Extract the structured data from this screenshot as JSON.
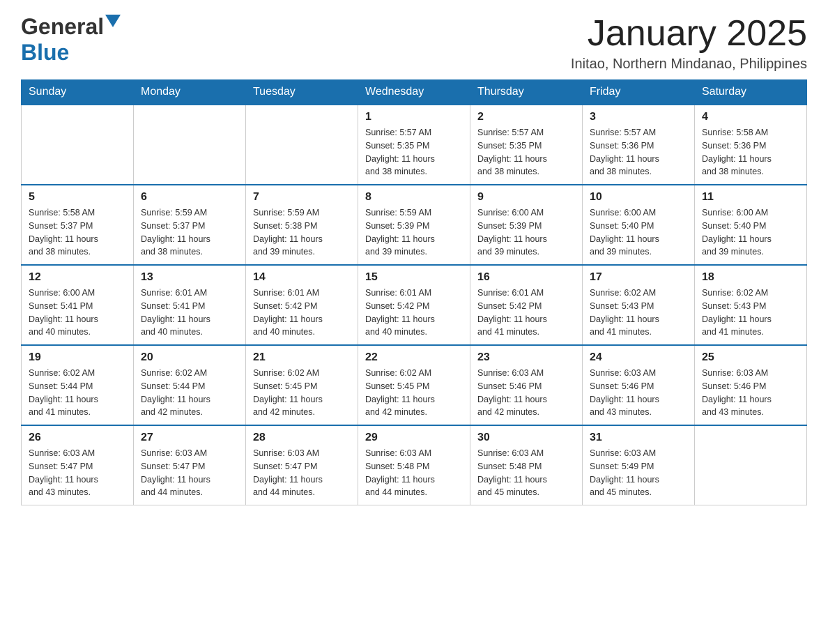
{
  "header": {
    "logo_general": "General",
    "logo_blue": "Blue",
    "month_title": "January 2025",
    "location": "Initao, Northern Mindanao, Philippines"
  },
  "days_of_week": [
    "Sunday",
    "Monday",
    "Tuesday",
    "Wednesday",
    "Thursday",
    "Friday",
    "Saturday"
  ],
  "weeks": [
    {
      "days": [
        {
          "number": "",
          "info": ""
        },
        {
          "number": "",
          "info": ""
        },
        {
          "number": "",
          "info": ""
        },
        {
          "number": "1",
          "info": "Sunrise: 5:57 AM\nSunset: 5:35 PM\nDaylight: 11 hours\nand 38 minutes."
        },
        {
          "number": "2",
          "info": "Sunrise: 5:57 AM\nSunset: 5:35 PM\nDaylight: 11 hours\nand 38 minutes."
        },
        {
          "number": "3",
          "info": "Sunrise: 5:57 AM\nSunset: 5:36 PM\nDaylight: 11 hours\nand 38 minutes."
        },
        {
          "number": "4",
          "info": "Sunrise: 5:58 AM\nSunset: 5:36 PM\nDaylight: 11 hours\nand 38 minutes."
        }
      ]
    },
    {
      "days": [
        {
          "number": "5",
          "info": "Sunrise: 5:58 AM\nSunset: 5:37 PM\nDaylight: 11 hours\nand 38 minutes."
        },
        {
          "number": "6",
          "info": "Sunrise: 5:59 AM\nSunset: 5:37 PM\nDaylight: 11 hours\nand 38 minutes."
        },
        {
          "number": "7",
          "info": "Sunrise: 5:59 AM\nSunset: 5:38 PM\nDaylight: 11 hours\nand 39 minutes."
        },
        {
          "number": "8",
          "info": "Sunrise: 5:59 AM\nSunset: 5:39 PM\nDaylight: 11 hours\nand 39 minutes."
        },
        {
          "number": "9",
          "info": "Sunrise: 6:00 AM\nSunset: 5:39 PM\nDaylight: 11 hours\nand 39 minutes."
        },
        {
          "number": "10",
          "info": "Sunrise: 6:00 AM\nSunset: 5:40 PM\nDaylight: 11 hours\nand 39 minutes."
        },
        {
          "number": "11",
          "info": "Sunrise: 6:00 AM\nSunset: 5:40 PM\nDaylight: 11 hours\nand 39 minutes."
        }
      ]
    },
    {
      "days": [
        {
          "number": "12",
          "info": "Sunrise: 6:00 AM\nSunset: 5:41 PM\nDaylight: 11 hours\nand 40 minutes."
        },
        {
          "number": "13",
          "info": "Sunrise: 6:01 AM\nSunset: 5:41 PM\nDaylight: 11 hours\nand 40 minutes."
        },
        {
          "number": "14",
          "info": "Sunrise: 6:01 AM\nSunset: 5:42 PM\nDaylight: 11 hours\nand 40 minutes."
        },
        {
          "number": "15",
          "info": "Sunrise: 6:01 AM\nSunset: 5:42 PM\nDaylight: 11 hours\nand 40 minutes."
        },
        {
          "number": "16",
          "info": "Sunrise: 6:01 AM\nSunset: 5:42 PM\nDaylight: 11 hours\nand 41 minutes."
        },
        {
          "number": "17",
          "info": "Sunrise: 6:02 AM\nSunset: 5:43 PM\nDaylight: 11 hours\nand 41 minutes."
        },
        {
          "number": "18",
          "info": "Sunrise: 6:02 AM\nSunset: 5:43 PM\nDaylight: 11 hours\nand 41 minutes."
        }
      ]
    },
    {
      "days": [
        {
          "number": "19",
          "info": "Sunrise: 6:02 AM\nSunset: 5:44 PM\nDaylight: 11 hours\nand 41 minutes."
        },
        {
          "number": "20",
          "info": "Sunrise: 6:02 AM\nSunset: 5:44 PM\nDaylight: 11 hours\nand 42 minutes."
        },
        {
          "number": "21",
          "info": "Sunrise: 6:02 AM\nSunset: 5:45 PM\nDaylight: 11 hours\nand 42 minutes."
        },
        {
          "number": "22",
          "info": "Sunrise: 6:02 AM\nSunset: 5:45 PM\nDaylight: 11 hours\nand 42 minutes."
        },
        {
          "number": "23",
          "info": "Sunrise: 6:03 AM\nSunset: 5:46 PM\nDaylight: 11 hours\nand 42 minutes."
        },
        {
          "number": "24",
          "info": "Sunrise: 6:03 AM\nSunset: 5:46 PM\nDaylight: 11 hours\nand 43 minutes."
        },
        {
          "number": "25",
          "info": "Sunrise: 6:03 AM\nSunset: 5:46 PM\nDaylight: 11 hours\nand 43 minutes."
        }
      ]
    },
    {
      "days": [
        {
          "number": "26",
          "info": "Sunrise: 6:03 AM\nSunset: 5:47 PM\nDaylight: 11 hours\nand 43 minutes."
        },
        {
          "number": "27",
          "info": "Sunrise: 6:03 AM\nSunset: 5:47 PM\nDaylight: 11 hours\nand 44 minutes."
        },
        {
          "number": "28",
          "info": "Sunrise: 6:03 AM\nSunset: 5:47 PM\nDaylight: 11 hours\nand 44 minutes."
        },
        {
          "number": "29",
          "info": "Sunrise: 6:03 AM\nSunset: 5:48 PM\nDaylight: 11 hours\nand 44 minutes."
        },
        {
          "number": "30",
          "info": "Sunrise: 6:03 AM\nSunset: 5:48 PM\nDaylight: 11 hours\nand 45 minutes."
        },
        {
          "number": "31",
          "info": "Sunrise: 6:03 AM\nSunset: 5:49 PM\nDaylight: 11 hours\nand 45 minutes."
        },
        {
          "number": "",
          "info": ""
        }
      ]
    }
  ]
}
